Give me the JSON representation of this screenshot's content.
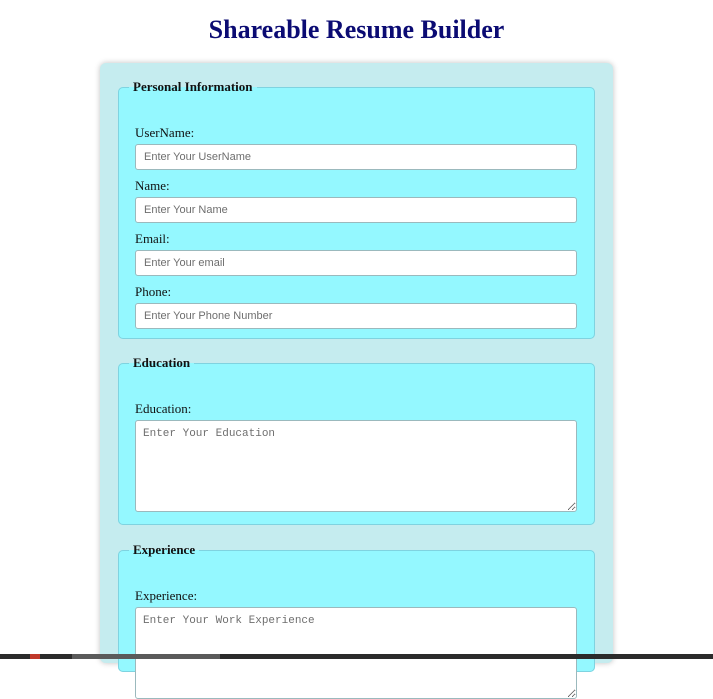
{
  "header": {
    "title": "Shareable Resume Builder"
  },
  "personal": {
    "legend": "Personal Information",
    "username_label": "UserName:",
    "username_placeholder": "Enter Your UserName",
    "name_label": "Name:",
    "name_placeholder": "Enter Your Name",
    "email_label": "Email:",
    "email_placeholder": "Enter Your email",
    "phone_label": "Phone:",
    "phone_placeholder": "Enter Your Phone Number"
  },
  "education": {
    "legend": "Education",
    "label": "Education:",
    "placeholder": "Enter Your Education"
  },
  "experience": {
    "legend": "Experience",
    "label": "Experience:",
    "placeholder": "Enter Your Work Experience"
  },
  "colors": {
    "title": "#0b0b73",
    "card_bg": "#c5ecef",
    "fieldset_bg": "#94f8ff"
  }
}
